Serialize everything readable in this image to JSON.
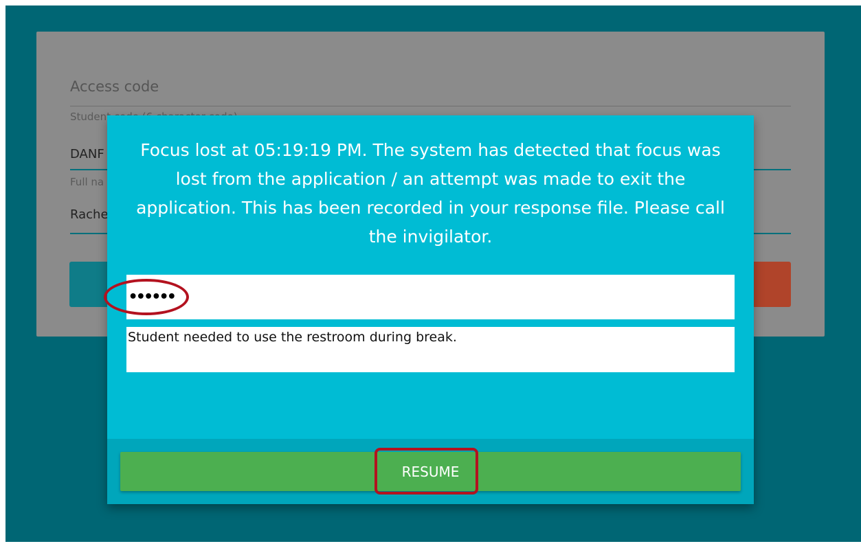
{
  "login_form": {
    "heading": "Access code",
    "student_code_label": "Student code (6 character code)",
    "student_code_value": "DANF",
    "full_name_label": "Full na",
    "full_name_value": "Rache"
  },
  "modal": {
    "message": "Focus lost at 05:19:19 PM. The system has detected that focus was lost from the application / an attempt was made to exit the application. This has been recorded in your response file. Please call the invigilator.",
    "pin_value": "••••••",
    "reason_value": "Student needed to use the restroom during break.",
    "resume_label": "RESUME"
  },
  "colors": {
    "backdrop": "#006674",
    "modal": "#00bcd4",
    "resume_button": "#4caf50",
    "annotation": "#b3121f"
  }
}
